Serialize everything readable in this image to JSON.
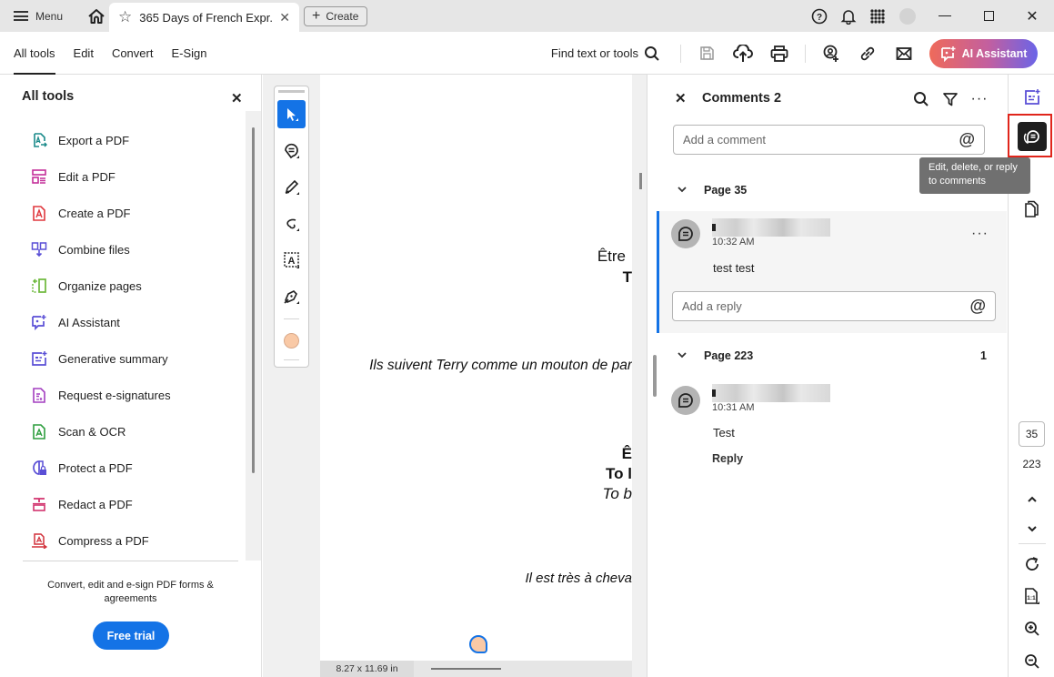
{
  "titlebar": {
    "menu_label": "Menu",
    "tab_title": "365 Days of French Expr...",
    "create_label": "Create",
    "icons": [
      "help-icon",
      "bell-icon",
      "apps-grid-icon",
      "user-avatar",
      "minimize-icon",
      "maximize-icon",
      "close-icon"
    ]
  },
  "toolbar": {
    "tabs": [
      {
        "label": "All tools",
        "active": true
      },
      {
        "label": "Edit"
      },
      {
        "label": "Convert"
      },
      {
        "label": "E-Sign"
      }
    ],
    "find_label": "Find text or tools",
    "ai_label": "AI Assistant"
  },
  "left_panel": {
    "title": "All tools",
    "items": [
      {
        "label": "Export a PDF",
        "icon": "export-pdf-icon",
        "color": "#1a8a8a"
      },
      {
        "label": "Edit a PDF",
        "icon": "edit-pdf-icon",
        "color": "#c4309a"
      },
      {
        "label": "Create a PDF",
        "icon": "create-pdf-icon",
        "color": "#e0383e"
      },
      {
        "label": "Combine files",
        "icon": "combine-files-icon",
        "color": "#5a4fd6"
      },
      {
        "label": "Organize pages",
        "icon": "organize-pages-icon",
        "color": "#6cb83a"
      },
      {
        "label": "AI Assistant",
        "icon": "ai-assistant-icon",
        "color": "#5a4fd6"
      },
      {
        "label": "Generative summary",
        "icon": "generative-summary-icon",
        "color": "#5a4fd6"
      },
      {
        "label": "Request e-signatures",
        "icon": "request-esign-icon",
        "color": "#a33fc0"
      },
      {
        "label": "Scan & OCR",
        "icon": "scan-ocr-icon",
        "color": "#2e9e3e"
      },
      {
        "label": "Protect a PDF",
        "icon": "protect-pdf-icon",
        "color": "#5a4fd6"
      },
      {
        "label": "Redact a PDF",
        "icon": "redact-pdf-icon",
        "color": "#d2336e"
      },
      {
        "label": "Compress a PDF",
        "icon": "compress-pdf-icon",
        "color": "#d2303a"
      }
    ],
    "promo_text": "Convert, edit and e-sign PDF forms & agreements",
    "free_trial_label": "Free trial"
  },
  "document": {
    "lines": [
      {
        "text": "Être",
        "style": "regular"
      },
      {
        "text": "T",
        "style": "bold"
      },
      {
        "text": "Ils suivent Terry comme un mouton de par",
        "style": "italic"
      },
      {
        "text": "Ê",
        "style": "bold"
      },
      {
        "text": "To l",
        "style": "bold"
      },
      {
        "text": "To b",
        "style": "italic"
      },
      {
        "text": "Il est très à cheva",
        "style": "italic"
      }
    ],
    "page_size": "8.27 x 11.69 in"
  },
  "comments": {
    "title": "Comments 2",
    "add_placeholder": "Add a comment",
    "groups": [
      {
        "page": "Page 35",
        "count": "",
        "comments": [
          {
            "author": "[redacted]",
            "time": "10:32 AM",
            "text": "test test",
            "reply_placeholder": "Add a reply"
          }
        ]
      },
      {
        "page": "Page 223",
        "count": "1",
        "comments": [
          {
            "author": "[redacted]",
            "time": "10:31 AM",
            "text": "Test",
            "reply_label": "Reply"
          }
        ]
      }
    ]
  },
  "right_rail": {
    "tooltip": "Edit, delete, or reply to comments",
    "current_page": "35",
    "total_pages": "223",
    "highlight_color": "#e0251b"
  }
}
